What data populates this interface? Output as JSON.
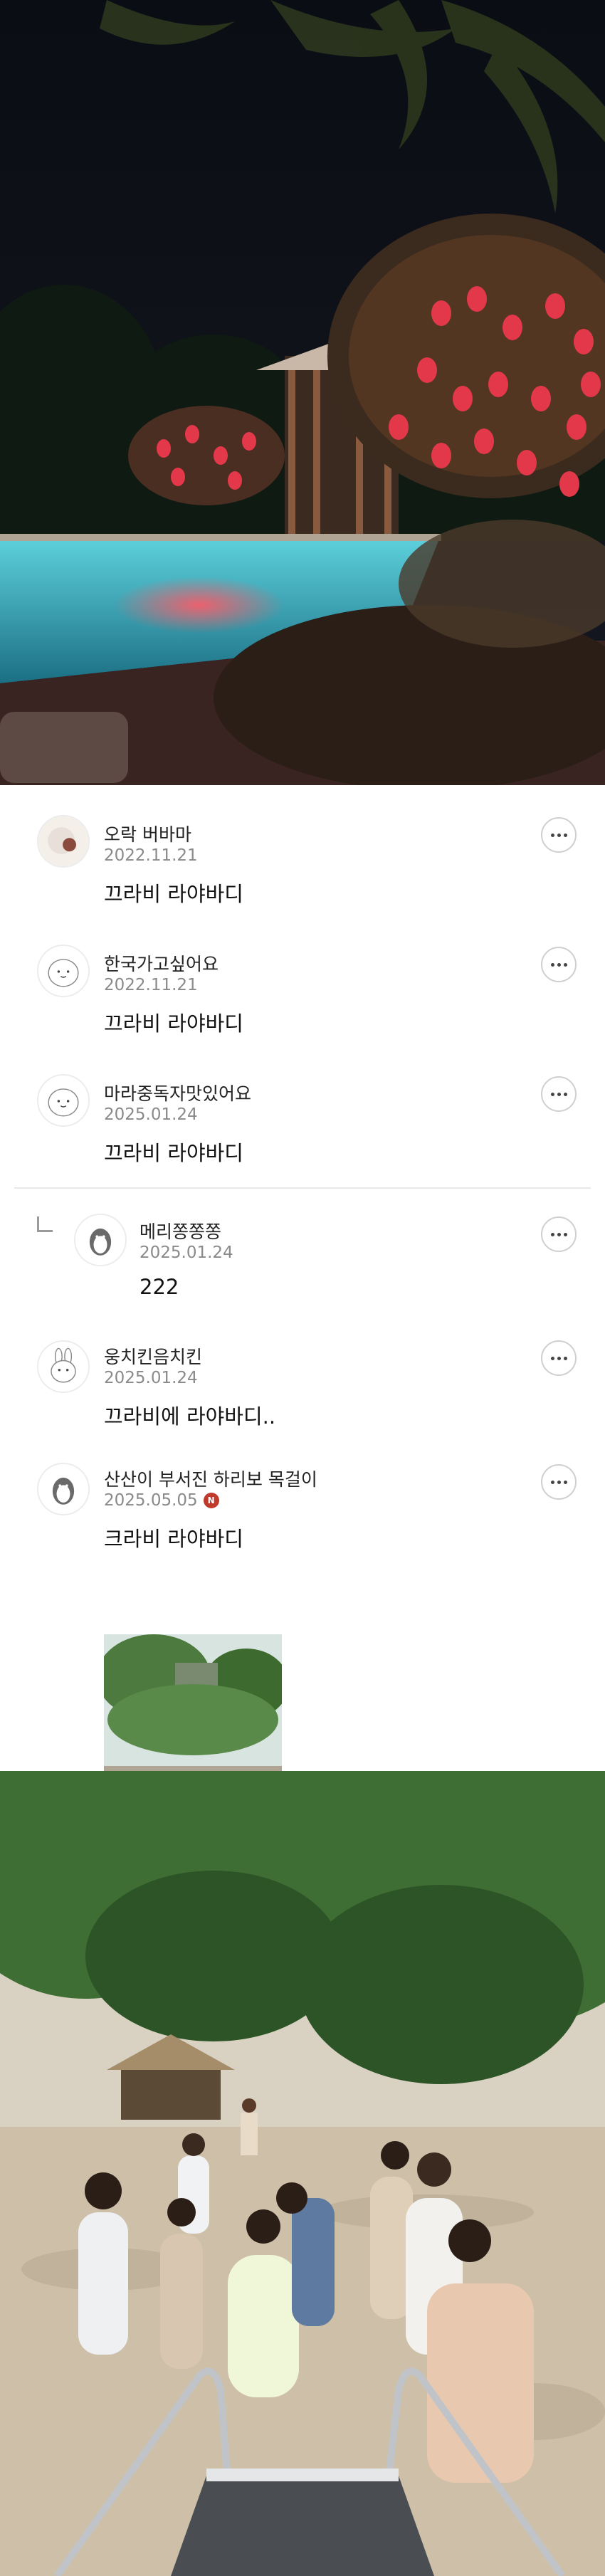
{
  "comments": [
    {
      "author": "오락 버바마",
      "date": "2022.11.21",
      "text": "끄라비 라야바디"
    },
    {
      "author": "한국가고싶어요",
      "date": "2022.11.21",
      "text": "끄라비 라야바디"
    },
    {
      "author": "마라중독자맛있어요",
      "date": "2025.01.24",
      "text": "끄라비 라야바디"
    },
    {
      "author": "메리쫑쫑쫑",
      "date": "2025.01.24",
      "text": "222"
    },
    {
      "author": "웅치킨음치킨",
      "date": "2025.01.24",
      "text": "끄라비에 라야바디.."
    },
    {
      "author": "산산이 부서진 하리보 목걸이",
      "date": "2025.05.05",
      "text": "크라비 라야바디",
      "badge": "N"
    }
  ],
  "icons": {
    "more": "more-options-icon",
    "reply": "reply-arrow-icon",
    "badge": "new-badge-icon"
  },
  "colors": {
    "badge": "#c0392b",
    "date": "#8a8a8a",
    "pool": "#3aa6b8",
    "lantern": "#e2384a"
  }
}
